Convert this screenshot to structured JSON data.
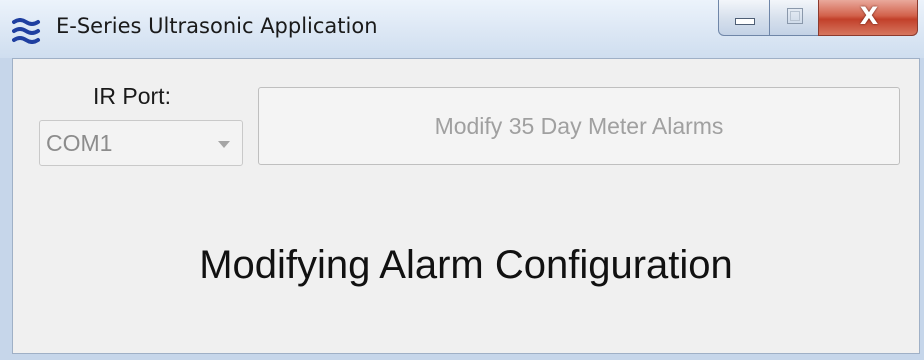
{
  "window": {
    "title": "E-Series Ultrasonic Application",
    "icon": "app-logo-icon",
    "close_glyph": "X"
  },
  "port": {
    "label": "IR Port:",
    "selected": "COM1"
  },
  "actions": {
    "modify_alarms_label": "Modify 35 Day Meter Alarms"
  },
  "status": {
    "message": "Modifying Alarm Configuration"
  },
  "colors": {
    "titlebar": "#dde8f5",
    "client_background": "#f0f0f0",
    "close_button": "#c2402a",
    "disabled_text": "#a0a0a0",
    "app_icon": "#1f3fa0"
  }
}
